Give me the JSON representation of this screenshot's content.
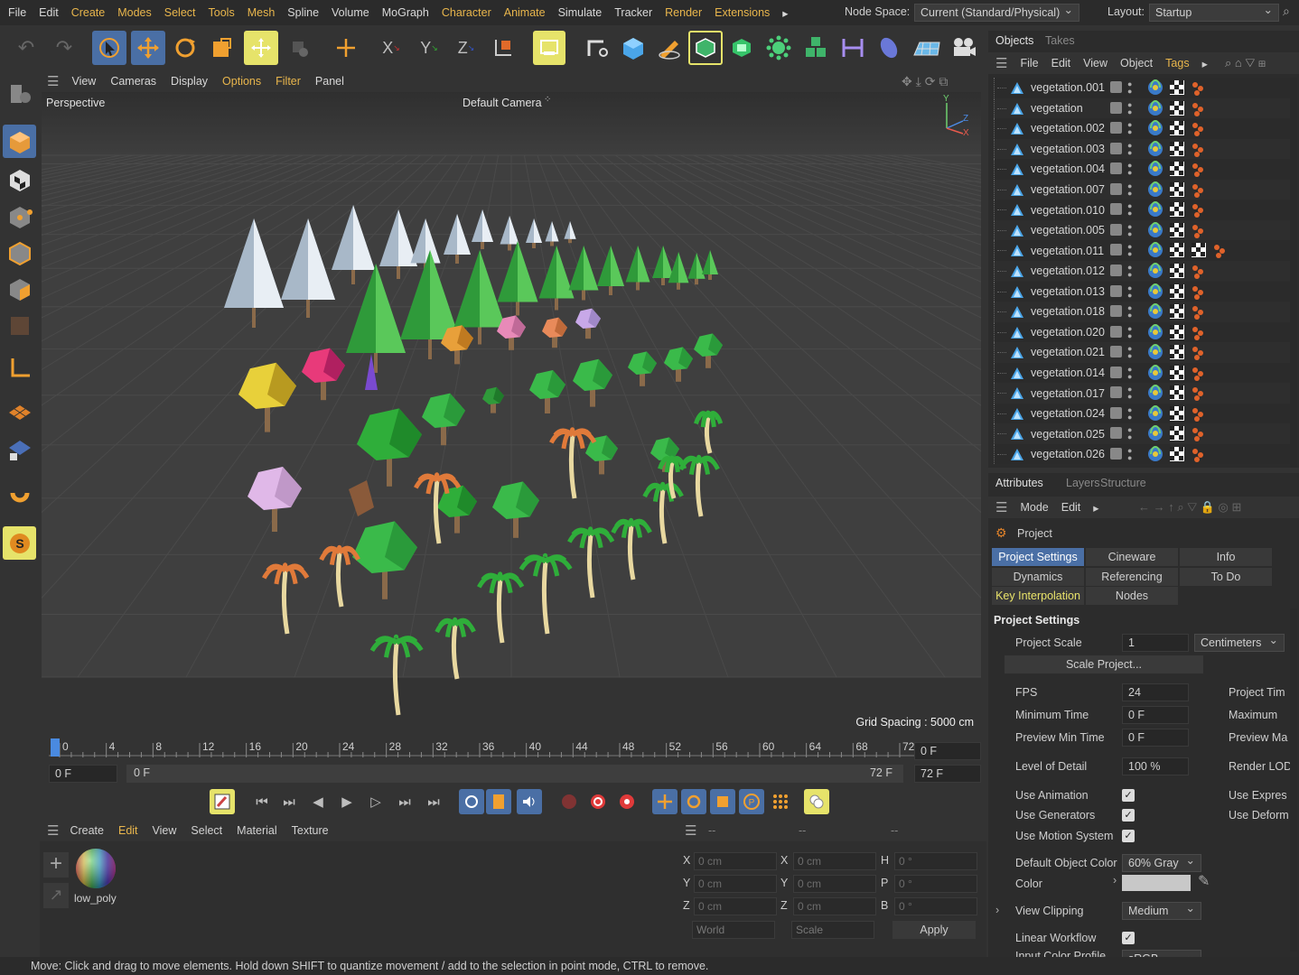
{
  "menubar": {
    "items": [
      "File",
      "Edit",
      "Create",
      "Modes",
      "Select",
      "Tools",
      "Mesh",
      "Spline",
      "Volume",
      "MoGraph",
      "Character",
      "Animate",
      "Simulate",
      "Tracker",
      "Render",
      "Extensions"
    ],
    "node_space_label": "Node Space:",
    "node_space_value": "Current (Standard/Physical)",
    "layout_label": "Layout:",
    "layout_value": "Startup"
  },
  "toolbar": {
    "icons": [
      "undo-icon",
      "redo-icon",
      "select-cursor-icon",
      "move-icon",
      "rotate-icon",
      "scale-icon",
      "live-selection-icon",
      "recent-tool-icon",
      "world-axis-icon",
      "x-axis-lock-icon",
      "y-axis-lock-icon",
      "z-axis-lock-icon",
      "coordinate-system-icon",
      "render-region-icon",
      "spline-pen-icon",
      "cube-icon",
      "sketch-icon",
      "subdivision-icon",
      "extrude-icon",
      "cloner-icon",
      "mograph-icon",
      "deformer-icon",
      "scene-icon",
      "floor-icon",
      "camera-icon"
    ],
    "axis_x": "X",
    "axis_y": "Y",
    "axis_z": "Z"
  },
  "viewport": {
    "menu": [
      "View",
      "Cameras",
      "Display",
      "Options",
      "Filter",
      "Panel"
    ],
    "projection": "Perspective",
    "camera": "Default Camera",
    "grid_spacing": "Grid Spacing : 5000 cm",
    "axis_labels": [
      "Y",
      "Z",
      "X"
    ]
  },
  "timeline": {
    "ticks": [
      "0",
      "4",
      "8",
      "12",
      "16",
      "20",
      "24",
      "28",
      "32",
      "36",
      "40",
      "44",
      "48",
      "52",
      "56",
      "60",
      "64",
      "68",
      "72"
    ],
    "current_frame": "0 F",
    "start_frame": "0 F",
    "range_start": "0 F",
    "range_end": "72 F",
    "end_frame": "72 F"
  },
  "materials": {
    "menu": [
      "Create",
      "Edit",
      "View",
      "Select",
      "Material",
      "Texture"
    ],
    "items": [
      {
        "name": "low_poly"
      }
    ]
  },
  "coordinates": {
    "header": [
      "--",
      "--",
      "--"
    ],
    "rows": [
      {
        "a": "X",
        "av": "0 cm",
        "b": "X",
        "bv": "0 cm",
        "c": "H",
        "cv": "0 °"
      },
      {
        "a": "Y",
        "av": "0 cm",
        "b": "Y",
        "bv": "0 cm",
        "c": "P",
        "cv": "0 °"
      },
      {
        "a": "Z",
        "av": "0 cm",
        "b": "Z",
        "bv": "0 cm",
        "c": "B",
        "cv": "0 °"
      }
    ],
    "world": "World",
    "scale": "Scale",
    "apply": "Apply"
  },
  "objects_panel": {
    "tabs": [
      "Objects",
      "Takes"
    ],
    "menu": [
      "File",
      "Edit",
      "View",
      "Object",
      "Tags"
    ],
    "rows": [
      "vegetation.001",
      "vegetation",
      "vegetation.002",
      "vegetation.003",
      "vegetation.004",
      "vegetation.007",
      "vegetation.010",
      "vegetation.005",
      "vegetation.011",
      "vegetation.012",
      "vegetation.013",
      "vegetation.018",
      "vegetation.020",
      "vegetation.021",
      "vegetation.014",
      "vegetation.017",
      "vegetation.024",
      "vegetation.025",
      "vegetation.026"
    ]
  },
  "attributes_panel": {
    "tabs": [
      "Attributes",
      "Layers",
      "Structure"
    ],
    "menu": [
      "Mode",
      "Edit"
    ],
    "object": "Project",
    "buttons": [
      "Project Settings",
      "Cineware",
      "Info",
      "Dynamics",
      "Referencing",
      "To Do",
      "Key Interpolation",
      "Nodes"
    ],
    "section": "Project Settings",
    "project_scale_label": "Project Scale",
    "project_scale_value": "1",
    "project_scale_unit": "Centimeters",
    "scale_project_button": "Scale Project...",
    "fps_label": "FPS",
    "fps_value": "24",
    "min_time_label": "Minimum Time",
    "min_time_value": "0 F",
    "prev_min_label": "Preview Min Time",
    "prev_min_value": "0 F",
    "lod_label": "Level of Detail",
    "lod_value": "100 %",
    "right_labels": [
      "Project Tim",
      "Maximum ",
      "Preview Ma",
      "Render LOD"
    ],
    "use_animation": "Use Animation",
    "use_generators": "Use Generators",
    "use_motion": "Use Motion System",
    "use_expressions": "Use Expres",
    "use_deformers": "Use Deform",
    "default_color_label": "Default Object Color",
    "default_color_value": "60% Gray",
    "color_label": "Color",
    "view_clipping_label": "View Clipping",
    "view_clipping_value": "Medium",
    "linear_workflow_label": "Linear Workflow",
    "input_color_label": "Input Color Profile",
    "input_color_value": "sRGB"
  },
  "status_bar": "Move: Click and drag to move elements. Hold down SHIFT to quantize movement / add to the selection in point mode, CTRL to remove."
}
